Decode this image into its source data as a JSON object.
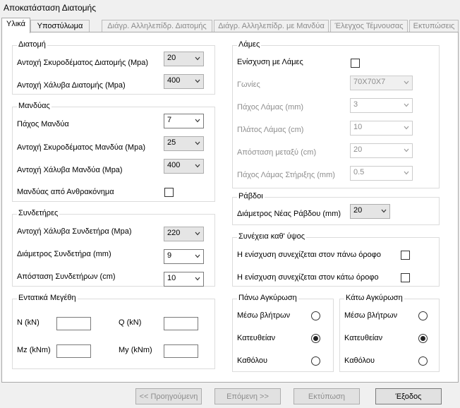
{
  "window": {
    "title": "Αποκατάσταση Διατομής"
  },
  "tabs": [
    {
      "label": "Υλικά"
    },
    {
      "label": "Υποστύλωμα"
    },
    {
      "label": "Διάγρ. Αλληλεπίδρ. Διατομής"
    },
    {
      "label": "Διάγρ. Αλληλεπίδρ. με Μανδύα"
    },
    {
      "label": "Έλεγχος Τέμνουσας"
    },
    {
      "label": "Εκτυπώσεις"
    }
  ],
  "section": {
    "title": "Διατομή",
    "concrete_label": "Αντοχή Σκυροδέματος Διατομής (Mpa)",
    "concrete_value": "20",
    "steel_label": "Αντοχή Χάλυβα Διατομής (Mpa)",
    "steel_value": "400"
  },
  "jacket": {
    "title": "Μανδύας",
    "thickness_label": "Πάχος Μανδύα",
    "thickness_value": "7",
    "concrete_label": "Αντοχή Σκυροδέματος Μανδύα (Mpa)",
    "concrete_value": "25",
    "steel_label": "Αντοχή Χάλυβα Μανδύα (Mpa)",
    "steel_value": "400",
    "carbon_label": "Μανδύας από Ανθρακόνημα"
  },
  "stirrups": {
    "title": "Συνδετήρες",
    "steel_label": "Αντοχή Χάλυβα Συνδετήρα (Mpa)",
    "steel_value": "220",
    "diameter_label": "Διάμετρος Συνδετήρα (mm)",
    "diameter_value": "9",
    "spacing_label": "Απόσταση Συνδετήρων (cm)",
    "spacing_value": "10"
  },
  "forces": {
    "title": "Εντατικά Μεγέθη",
    "n_label": "N (kN)",
    "q_label": "Q (kN)",
    "mz_label": "Mz (kNm)",
    "my_label": "My (kNm)"
  },
  "plates": {
    "title": "Λάμες",
    "enable_label": "Ενίσχυση με Λάμες",
    "angles_label": "Γωνίες",
    "angles_value": "70X70X7",
    "thickness_label": "Πάχος Λάμας (mm)",
    "thickness_value": "3",
    "width_label": "Πλάτος Λάμας (cm)",
    "width_value": "10",
    "spacing_label": "Απόσταση μεταξύ (cm)",
    "spacing_value": "20",
    "support_label": "Πάχος Λάμας Στήριξης (mm)",
    "support_value": "0.5"
  },
  "bars": {
    "title": "Ράβδοι",
    "diameter_label": "Διάμετρος Νέας Ράβδου (mm)",
    "diameter_value": "20"
  },
  "continuity": {
    "title": "Συνέχεια καθ' ύψος",
    "upper_label": "Η ενίσχυση συνεχίζεται στον πάνω όροφο",
    "lower_label": "Η ενίσχυση συνεχίζεται στον κάτω όροφο"
  },
  "upper_anchor": {
    "title": "Πάνω Αγκύρωση",
    "opt1": "Μέσω βλήτρων",
    "opt2": "Κατευθείαν",
    "opt3": "Καθόλου"
  },
  "lower_anchor": {
    "title": "Κάτω Αγκύρωση",
    "opt1": "Μέσω βλήτρων",
    "opt2": "Κατευθείαν",
    "opt3": "Καθόλου"
  },
  "buttons": {
    "prev": "<< Προηγούμενη",
    "next": "Επόμενη >>",
    "print": "Εκτύπωση",
    "exit": "Έξοδος"
  }
}
